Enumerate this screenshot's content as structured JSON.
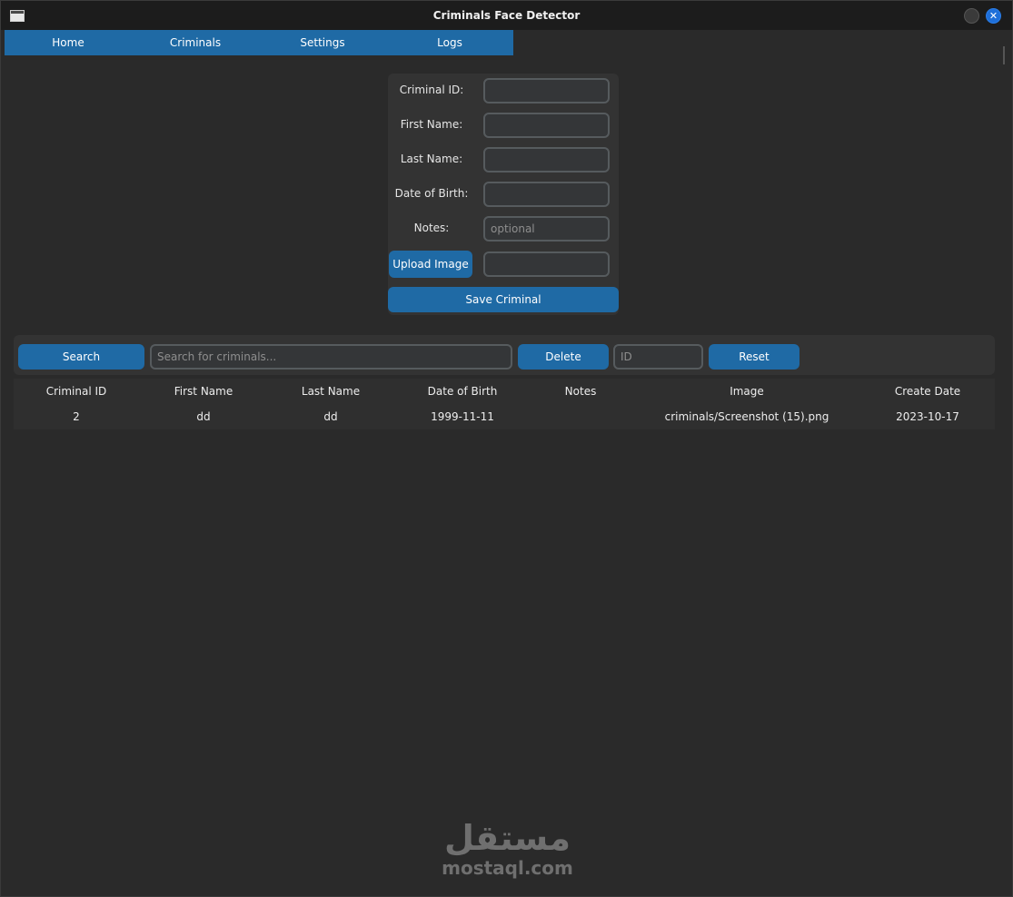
{
  "window": {
    "title": "Criminals Face Detector",
    "close_glyph": "✕"
  },
  "nav": {
    "tabs": [
      {
        "label": "Home"
      },
      {
        "label": "Criminals"
      },
      {
        "label": "Settings"
      },
      {
        "label": "Logs"
      }
    ]
  },
  "form": {
    "criminal_id_label": "Criminal ID:",
    "first_name_label": "First Name:",
    "last_name_label": "Last Name:",
    "dob_label": "Date of Birth:",
    "notes_label": "Notes:",
    "notes_placeholder": "optional",
    "upload_label": "Upload Image",
    "save_label": "Save Criminal"
  },
  "toolbar": {
    "search_label": "Search",
    "search_placeholder": "Search for criminals...",
    "delete_label": "Delete",
    "id_placeholder": "ID",
    "reset_label": "Reset"
  },
  "table": {
    "headers": [
      "Criminal ID",
      "First Name",
      "Last Name",
      "Date of Birth",
      "Notes",
      "Image",
      "Create Date"
    ],
    "rows": [
      [
        "2",
        "dd",
        "dd",
        "1999-11-11",
        "",
        "criminals/Screenshot (15).png",
        "2023-10-17"
      ]
    ]
  },
  "watermark": {
    "logo_text": "مستقل",
    "domain": "mostaql.com"
  },
  "colors": {
    "accent": "#1f6aa5",
    "background": "#2a2a2a",
    "panel": "#333333"
  }
}
